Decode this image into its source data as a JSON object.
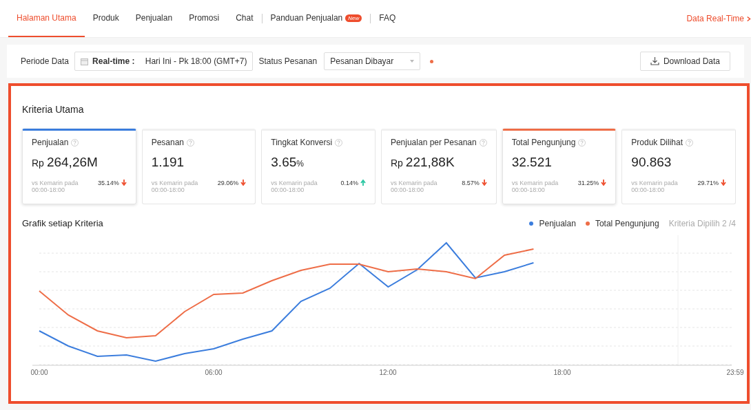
{
  "tabs": [
    {
      "label": "Halaman Utama",
      "selected": true
    },
    {
      "label": "Produk",
      "selected": false
    },
    {
      "label": "Penjualan",
      "selected": false
    },
    {
      "label": "Promosi",
      "selected": false
    },
    {
      "label": "Chat",
      "selected": false
    },
    {
      "label": "Panduan Penjualan",
      "selected": false,
      "badge": "New"
    },
    {
      "label": "FAQ",
      "selected": false
    }
  ],
  "realtime_link": "Data Real-Time",
  "filters": {
    "period_label": "Periode Data",
    "period_mode": "Real-time :",
    "period_value": "Hari Ini - Pk 18:00 (GMT+7)",
    "status_label": "Status Pesanan",
    "status_value": "Pesanan Dibayar",
    "download": "Download Data"
  },
  "section_title": "Kriteria Utama",
  "metrics": [
    {
      "name": "Penjualan",
      "prefix": "Rp",
      "value": "264,26M",
      "compare": "vs Kemarin pada 00:00-18:00",
      "change": "35.14%",
      "increased": false,
      "selected": true,
      "color": "#3b7ddd"
    },
    {
      "name": "Pesanan",
      "value": "1.191",
      "compare": "vs Kemarin pada 00:00-18:00",
      "change": "29.06%",
      "increased": false,
      "selected": false
    },
    {
      "name": "Tingkat Konversi",
      "value": "3.65",
      "unit": "%",
      "compare": "vs Kemarin pada 00:00-18:00",
      "change": "0.14%",
      "increased": true,
      "selected": false
    },
    {
      "name": "Penjualan per Pesanan",
      "prefix": "Rp",
      "value": "221,88K",
      "compare": "vs Kemarin pada 00:00-18:00",
      "change": "8.57%",
      "increased": false,
      "selected": false
    },
    {
      "name": "Total Pengunjung",
      "value": "32.521",
      "compare": "vs Kemarin pada 00:00-18:00",
      "change": "31.25%",
      "increased": false,
      "selected": true,
      "color": "#ee6d47"
    },
    {
      "name": "Produk Dilihat",
      "value": "90.863",
      "compare": "vs Kemarin pada 00:00-18:00",
      "change": "29.71%",
      "increased": false,
      "selected": false
    }
  ],
  "chart": {
    "title": "Grafik setiap Kriteria",
    "legend": [
      {
        "label": "Penjualan",
        "color": "#3b7ddd"
      },
      {
        "label": "Total Pengunjung",
        "color": "#ee6d47"
      }
    ],
    "selected_count": "Kriteria Dipilih 2 /4",
    "x_labels": [
      "00:00",
      "06:00",
      "12:00",
      "18:00",
      "23:59"
    ]
  }
}
